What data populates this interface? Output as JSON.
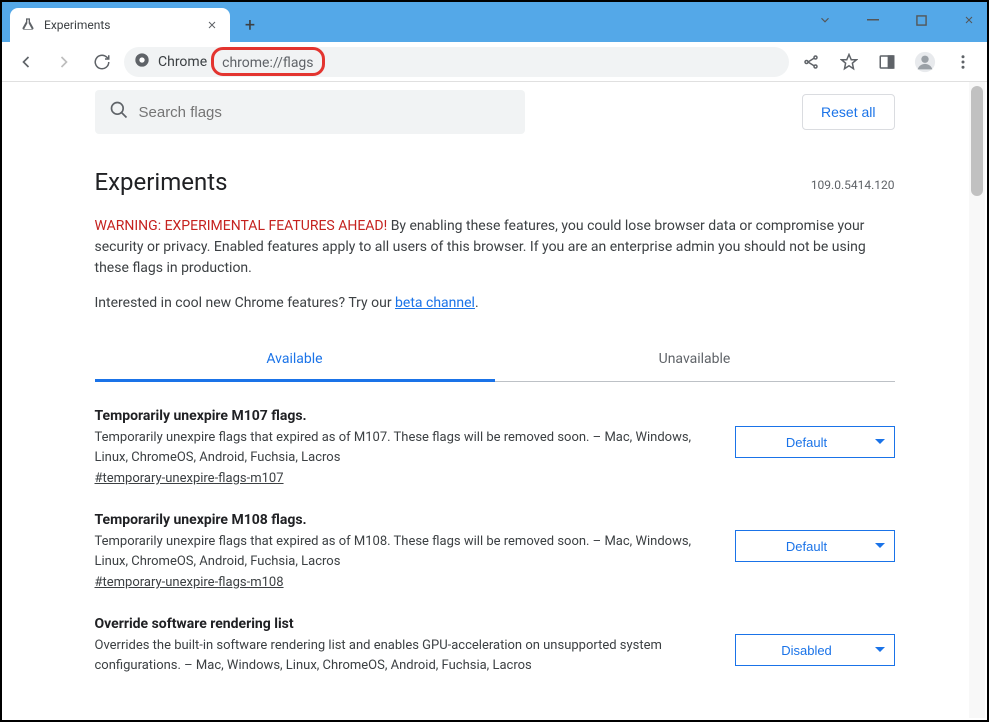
{
  "tab": {
    "title": "Experiments"
  },
  "address": {
    "label": "Chrome",
    "url": "chrome://flags"
  },
  "search": {
    "placeholder": "Search flags"
  },
  "reset": "Reset all",
  "heading": "Experiments",
  "version": "109.0.5414.120",
  "warning": {
    "bold": "WARNING: EXPERIMENTAL FEATURES AHEAD!",
    "rest": " By enabling these features, you could lose browser data or compromise your security or privacy. Enabled features apply to all users of this browser. If you are an enterprise admin you should not be using these flags in production."
  },
  "interest": {
    "text": "Interested in cool new Chrome features? Try our ",
    "link": "beta channel",
    "after": "."
  },
  "tabs": {
    "available": "Available",
    "unavailable": "Unavailable"
  },
  "flags": [
    {
      "title": "Temporarily unexpire M107 flags.",
      "desc": "Temporarily unexpire flags that expired as of M107. These flags will be removed soon. – Mac, Windows, Linux, ChromeOS, Android, Fuchsia, Lacros",
      "link": "#temporary-unexpire-flags-m107",
      "value": "Default"
    },
    {
      "title": "Temporarily unexpire M108 flags.",
      "desc": "Temporarily unexpire flags that expired as of M108. These flags will be removed soon. – Mac, Windows, Linux, ChromeOS, Android, Fuchsia, Lacros",
      "link": "#temporary-unexpire-flags-m108",
      "value": "Default"
    },
    {
      "title": "Override software rendering list",
      "desc": "Overrides the built-in software rendering list and enables GPU-acceleration on unsupported system configurations. – Mac, Windows, Linux, ChromeOS, Android, Fuchsia, Lacros",
      "link": "",
      "value": "Disabled"
    }
  ]
}
